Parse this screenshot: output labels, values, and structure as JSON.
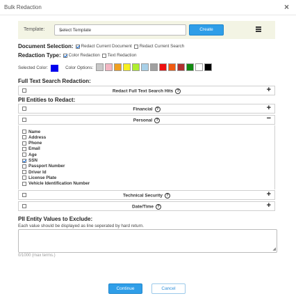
{
  "dialog": {
    "title": "Bulk Redaction",
    "close_icon": "close-icon"
  },
  "template": {
    "label": "Template:",
    "selected": "Select Template",
    "create_label": "Create",
    "list_icon": "list-icon"
  },
  "document_selection": {
    "label": "Document Selection:",
    "opt1": "Redact Current Document",
    "opt1_checked": true,
    "opt2": "Redact Current Search",
    "opt2_checked": false
  },
  "redaction_type": {
    "label": "Redaction Type:",
    "opt1": "Color Redaction",
    "opt1_checked": true,
    "opt2": "Text Redaction",
    "opt2_checked": false
  },
  "color": {
    "selected_label": "Selected Color:",
    "selected_color": "#0000ee",
    "options_label": "Color Options:",
    "options": [
      "#c8c8c8",
      "#f4b6c2",
      "#f0a020",
      "#f7f020",
      "#b0ee30",
      "#a8d0e8",
      "#a0a0a0",
      "#ee1010",
      "#f05a10",
      "#b03030",
      "#108a10",
      "#ffffff",
      "#000000"
    ]
  },
  "full_text": {
    "heading": "Full Text Search Redaction:",
    "panel_title": "Redact Full Text Search Hits"
  },
  "pii": {
    "heading": "PII Entities to Redact:",
    "panels": {
      "financial": "Financial",
      "personal": "Personal",
      "technical": "Technical Security",
      "datetime": "Date/Time"
    },
    "personal_entities": [
      "Name",
      "Address",
      "Phone",
      "Email",
      "Age",
      "SSN",
      "Passport Number",
      "Driver Id",
      "License Plate",
      "Vehicle Identification Number"
    ],
    "checked": [
      "SSN"
    ]
  },
  "exclude": {
    "heading": "PII Entity Values to Exclude:",
    "help": "Each value should be displayed as line seperated by hard return.",
    "counter": "0/1000 (max terms.)"
  },
  "footer": {
    "continue_label": "Continue",
    "cancel_label": "Cancel"
  }
}
